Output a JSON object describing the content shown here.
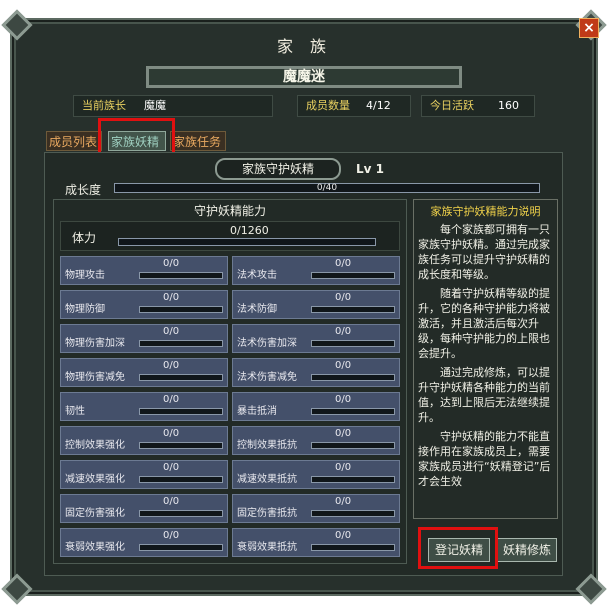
{
  "window": {
    "title": "家 族",
    "close_label": "×"
  },
  "family": {
    "name": "魔魔迷",
    "leader_label": "当前族长",
    "leader_value": "魔魔",
    "members_label": "成员数量",
    "members_value": "4/12",
    "activity_label": "今日活跃",
    "activity_value": "160"
  },
  "tabs": [
    {
      "label": "成员列表",
      "active": false
    },
    {
      "label": "家族妖精",
      "active": true
    },
    {
      "label": "家族任务",
      "active": false
    }
  ],
  "spirit": {
    "title": "家族守护妖精",
    "level": "Lv 1",
    "growth_label": "成长度",
    "growth_text": "0/40",
    "growth_fraction": 0
  },
  "abilities": {
    "section_title": "守护妖精能力",
    "hp_label": "体力",
    "hp_value": "0/1260",
    "items": [
      {
        "label": "物理攻击",
        "value": "0/0"
      },
      {
        "label": "法术攻击",
        "value": "0/0"
      },
      {
        "label": "物理防御",
        "value": "0/0"
      },
      {
        "label": "法术防御",
        "value": "0/0"
      },
      {
        "label": "物理伤害加深",
        "value": "0/0"
      },
      {
        "label": "法术伤害加深",
        "value": "0/0"
      },
      {
        "label": "物理伤害减免",
        "value": "0/0"
      },
      {
        "label": "法术伤害减免",
        "value": "0/0"
      },
      {
        "label": "韧性",
        "value": "0/0"
      },
      {
        "label": "暴击抵消",
        "value": "0/0"
      },
      {
        "label": "控制效果强化",
        "value": "0/0"
      },
      {
        "label": "控制效果抵抗",
        "value": "0/0"
      },
      {
        "label": "减速效果强化",
        "value": "0/0"
      },
      {
        "label": "减速效果抵抗",
        "value": "0/0"
      },
      {
        "label": "固定伤害强化",
        "value": "0/0"
      },
      {
        "label": "固定伤害抵抗",
        "value": "0/0"
      },
      {
        "label": "衰弱效果强化",
        "value": "0/0"
      },
      {
        "label": "衰弱效果抵抗",
        "value": "0/0"
      }
    ]
  },
  "description": {
    "title": "家族守护妖精能力说明",
    "paragraphs": [
      "每个家族都可拥有一只家族守护妖精。通过完成家族任务可以提升守护妖精的成长度和等级。",
      "随着守护妖精等级的提升，它的各种守护能力将被激活，并且激活后每次升级，每种守护能力的上限也会提升。",
      "通过完成修炼，可以提升守护妖精各种能力的当前值，达到上限后无法继续提升。",
      "守护妖精的能力不能直接作用在家族成员上，需要家族成员进行“妖精登记”后才会生效"
    ]
  },
  "buttons": {
    "register": "登记妖精",
    "train": "妖精修炼"
  },
  "colors": {
    "highlight": "#e01010",
    "gold_label": "#e8d060",
    "tab_inactive": "#e8a860"
  }
}
